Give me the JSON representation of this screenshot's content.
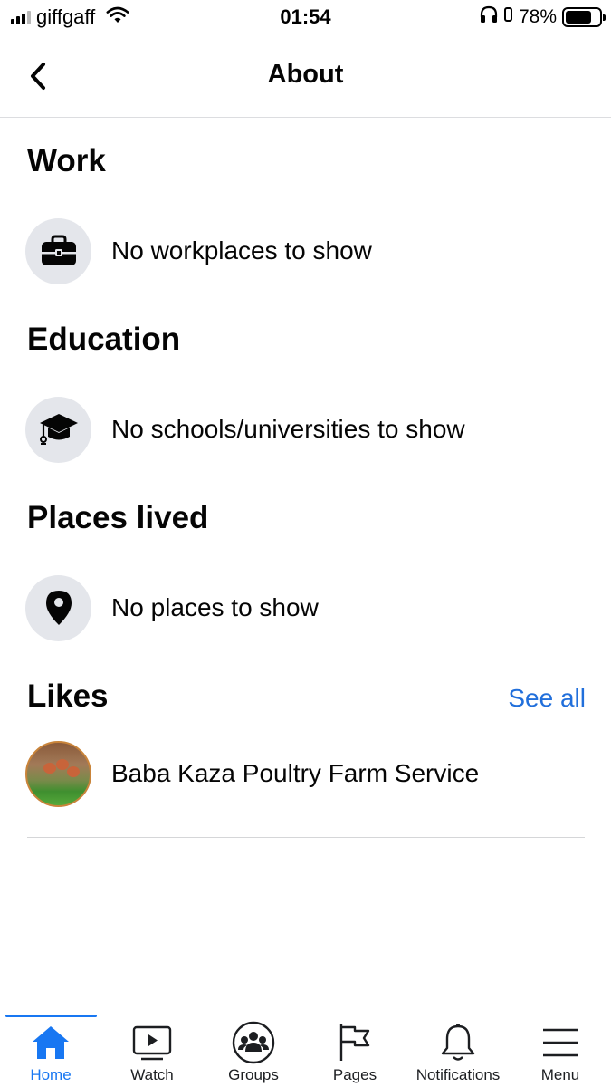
{
  "status_bar": {
    "carrier": "giffgaff",
    "time": "01:54",
    "battery_percent": "78%",
    "battery_level": 0.78
  },
  "header": {
    "title": "About",
    "back_icon": "chevron-left-icon"
  },
  "sections": {
    "work": {
      "heading": "Work",
      "empty_text": "No workplaces to show",
      "icon": "briefcase-icon"
    },
    "education": {
      "heading": "Education",
      "empty_text": "No schools/universities to show",
      "icon": "graduation-cap-icon"
    },
    "places": {
      "heading": "Places lived",
      "empty_text": "No places to show",
      "icon": "location-pin-icon"
    },
    "likes": {
      "heading": "Likes",
      "see_all_label": "See all",
      "items": [
        {
          "name": "Baba Kaza Poultry Farm Service"
        }
      ]
    }
  },
  "tab_bar": {
    "active": "home",
    "accent_color": "#1877f2",
    "tabs": [
      {
        "label": "Home",
        "icon": "home-icon"
      },
      {
        "label": "Watch",
        "icon": "watch-video-icon"
      },
      {
        "label": "Groups",
        "icon": "groups-icon"
      },
      {
        "label": "Pages",
        "icon": "flag-icon"
      },
      {
        "label": "Notifications",
        "icon": "bell-icon"
      },
      {
        "label": "Menu",
        "icon": "hamburger-menu-icon"
      }
    ]
  }
}
